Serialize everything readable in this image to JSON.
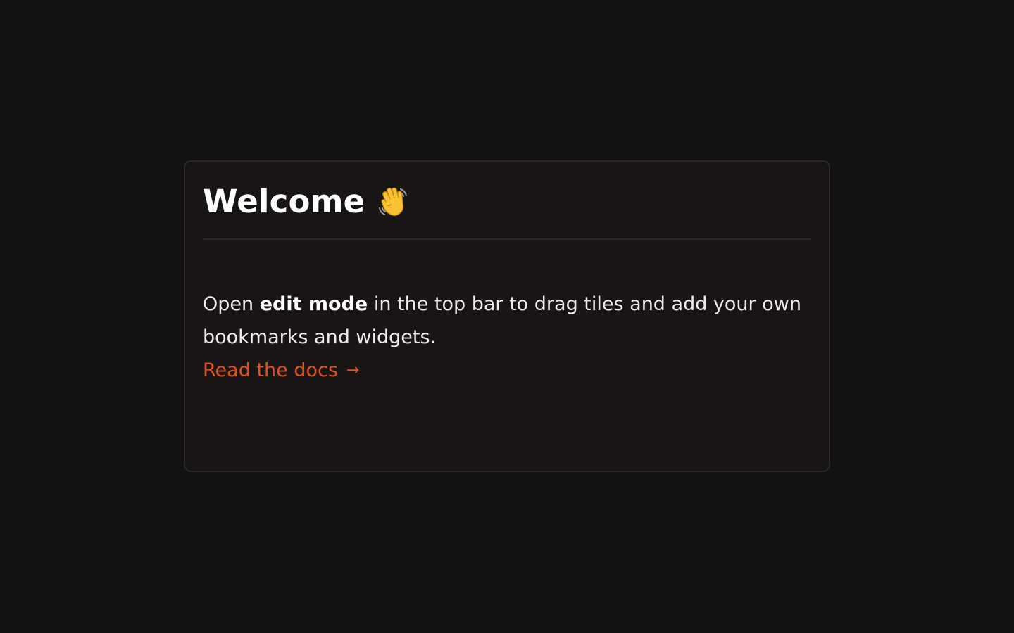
{
  "welcome": {
    "title": "Welcome",
    "body_prefix": "Open ",
    "body_bold": "edit mode",
    "body_suffix": " in the top bar to drag tiles and add your own bookmarks and widgets.",
    "link_label": "Read the docs",
    "link_arrow": "→",
    "wave_icon": "waving-hand-icon"
  },
  "colors": {
    "background": "#111111",
    "card": "#181514",
    "accent": "#e0531f",
    "text": "#ffffff"
  }
}
